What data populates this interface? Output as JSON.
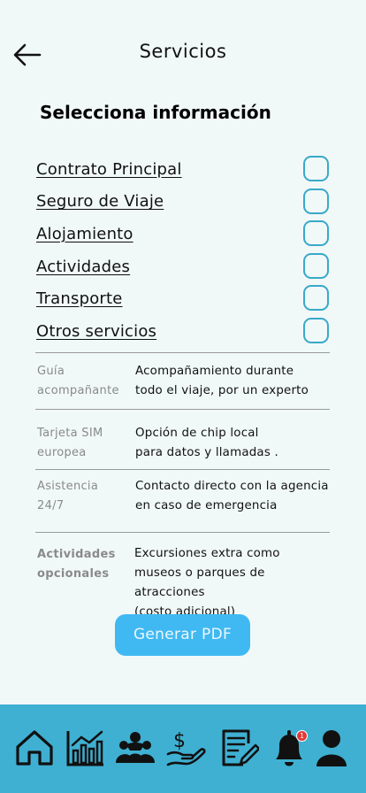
{
  "header": {
    "title": "Servicios"
  },
  "section": {
    "title": "Selecciona información"
  },
  "options": [
    {
      "label": "Contrato Principal",
      "checked": false
    },
    {
      "label": "Seguro de Viaje",
      "checked": false
    },
    {
      "label": "Alojamiento",
      "checked": false
    },
    {
      "label": "Actividades",
      "checked": false
    },
    {
      "label": "Transporte",
      "checked": false
    },
    {
      "label": "Otros servicios",
      "checked": false
    }
  ],
  "info_rows": [
    {
      "label": "Guía\nacompañante",
      "description": "Acompañamiento  durante\ntodo el viaje, por un experto"
    },
    {
      "label": "Tarjeta SIM\neuropea",
      "description": "Opción de chip local\npara datos y llamadas ."
    },
    {
      "label": "Asistencia\n24/7",
      "description": "Contacto directo con la agencia\nen caso de emergencia"
    },
    {
      "label": "Actividades\nopcionales",
      "description": "Excursiones extra como\n museos o parques  de atracciones\n(costo adicional)"
    }
  ],
  "actions": {
    "generate_pdf_label": "Generar PDF"
  },
  "bottom_nav": {
    "items": [
      {
        "icon": "home-icon"
      },
      {
        "icon": "chart-icon"
      },
      {
        "icon": "group-icon"
      },
      {
        "icon": "payment-icon"
      },
      {
        "icon": "document-icon"
      },
      {
        "icon": "bell-icon",
        "badge": "1"
      },
      {
        "icon": "profile-icon"
      }
    ]
  },
  "colors": {
    "background": "#f1f8f8",
    "accent": "#38a9c9",
    "button": "#40b9f2",
    "nav_background": "#3fb0d2",
    "badge": "#e53935"
  }
}
